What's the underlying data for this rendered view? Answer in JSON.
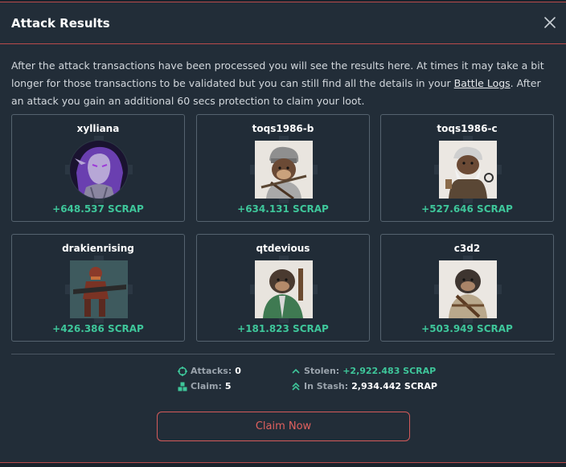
{
  "modal": {
    "title": "Attack Results",
    "description_part1": "After the attack transactions have been processed you will see the results here. At times it may take a bit longer for those transactions to be validated but you can still find all the details in your ",
    "battle_logs_link": "Battle Logs",
    "description_part2": ". After an attack you gain an additional 60 secs protection to claim your loot."
  },
  "results": [
    {
      "name": "xylliana",
      "amount": "+648.537 SCRAP",
      "avatar": "elf-portrait"
    },
    {
      "name": "toqs1986-b",
      "amount": "+634.131 SCRAP",
      "avatar": "monkey-rifle"
    },
    {
      "name": "toqs1986-c",
      "amount": "+527.646 SCRAP",
      "avatar": "old-monkey-beard"
    },
    {
      "name": "drakienrising",
      "amount": "+426.386 SCRAP",
      "avatar": "armored-soldier"
    },
    {
      "name": "qtdevious",
      "amount": "+181.823 SCRAP",
      "avatar": "monkey-green-jacket"
    },
    {
      "name": "c3d2",
      "amount": "+503.949 SCRAP",
      "avatar": "monkey-bandolier"
    }
  ],
  "stats": {
    "attacks_label": "Attacks:",
    "attacks_value": "0",
    "claim_label": "Claim:",
    "claim_value": "5",
    "stolen_label": "Stolen:",
    "stolen_value": "+2,922.483 SCRAP",
    "stash_label": "In Stash:",
    "stash_value": "2,934.442 SCRAP"
  },
  "actions": {
    "claim_now": "Claim Now"
  },
  "colors": {
    "accent_red": "#d45a5a",
    "scrap_green": "#3ec69a",
    "panel": "#222d38"
  }
}
